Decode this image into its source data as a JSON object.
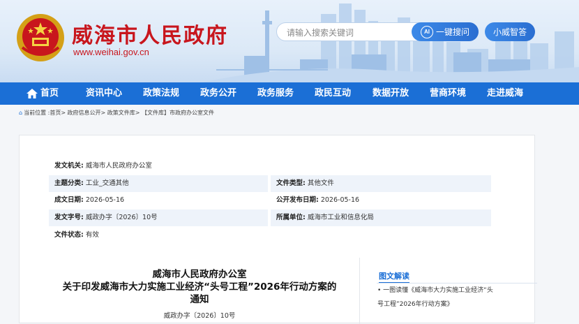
{
  "site": {
    "title": "威海市人民政府",
    "url": "www.weihai.gov.cn"
  },
  "search": {
    "placeholder": "请输入搜索关键词",
    "button_label": "一键搜问",
    "ai_badge": "AI",
    "assistant_label": "小威智答"
  },
  "nav": {
    "items": [
      "首页",
      "资讯中心",
      "政策法规",
      "政务公开",
      "政务服务",
      "政民互动",
      "数据开放",
      "营商环境",
      "走进威海"
    ]
  },
  "breadcrumb": {
    "text": "当前位置 :首页> 政府信息公开> 政策文件库> 【文件库】市政府办公室文件"
  },
  "meta": {
    "issuer_label": "发文机关:",
    "issuer_value": "威海市人民政府办公室",
    "topic_label": "主题分类:",
    "topic_value": "工业_交通其他",
    "doctype_label": "文件类型:",
    "doctype_value": "其他文件",
    "written_label": "成文日期:",
    "written_value": "2026-05-16",
    "published_label": "公开发布日期:",
    "published_value": "2026-05-16",
    "docnum_label": "发文字号:",
    "docnum_value": "威政办字〔2026〕10号",
    "unit_label": "所属单位:",
    "unit_value": "威海市工业和信息化局",
    "status_label": "文件状态:",
    "status_value": "有效"
  },
  "document": {
    "title_line1": "威海市人民政府办公室",
    "title_line2": "关于印发威海市大力实施工业经济“头号工程”2026年行动方案的",
    "title_line3": "通知",
    "number": "威政办字〔2026〕10号"
  },
  "sidebar": {
    "heading": "图文解读",
    "link_line1": "• 一图读懂《威海市大力实施工业经济“头",
    "link_line2": "号工程”2026年行动方案》"
  },
  "colors": {
    "brand_red": "#c8161d",
    "nav_blue": "#1b6fd6"
  }
}
